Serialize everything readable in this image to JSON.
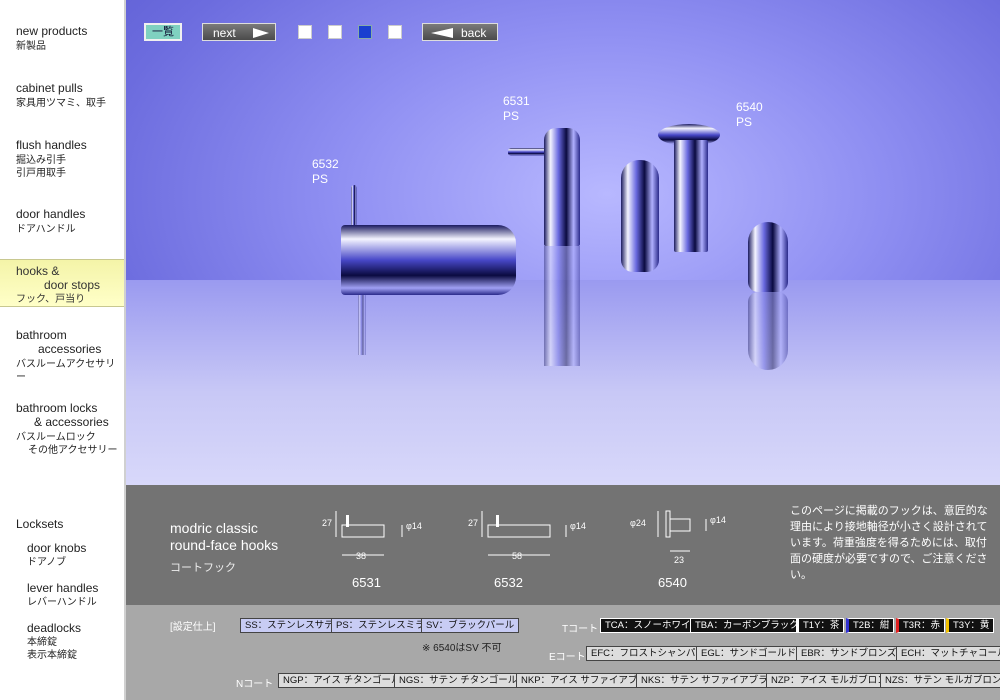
{
  "sidebar": {
    "items": [
      {
        "en": "new products",
        "jp": "新製品"
      },
      {
        "en": "cabinet pulls",
        "jp": "家具用ツマミ、取手"
      },
      {
        "en": "flush handles",
        "jp": "掘込み引手",
        "jp2": "引戸用取手"
      },
      {
        "en": "door handles",
        "jp": "ドアハンドル"
      },
      {
        "en": "hooks &",
        "en2": "door stops",
        "jp": "フック、戸当り"
      },
      {
        "en": "bathroom",
        "en2": "accessories",
        "jp": "バスルームアクセサリー"
      },
      {
        "en": "bathroom locks",
        "en2": "& accessories",
        "jp": "バスルームロック",
        "jp2": "その他アクセサリー"
      }
    ],
    "locksets_heading": "Locksets",
    "locksets": [
      {
        "en": "door knobs",
        "jp": "ドアノブ"
      },
      {
        "en": "lever handles",
        "jp": "レバーハンドル"
      },
      {
        "en": "deadlocks",
        "jp": "本締錠",
        "jp2": "表示本締錠"
      }
    ],
    "active_index": 4
  },
  "toolbar": {
    "list_label": "一覧",
    "next_label": "next",
    "back_label": "back",
    "page_count": 4,
    "current_page": 3
  },
  "photo": {
    "labels": [
      {
        "code": "6532",
        "finish": "PS"
      },
      {
        "code": "6531",
        "finish": "PS"
      },
      {
        "code": "6540",
        "finish": "PS"
      }
    ]
  },
  "info": {
    "name_line1": "modric classic",
    "name_line2": "round-face hooks",
    "name_jp": "コートフック",
    "drawings": [
      {
        "code": "6531",
        "height": "27",
        "dia": "φ14",
        "length": "38"
      },
      {
        "code": "6532",
        "height": "27",
        "dia": "φ14",
        "length": "58"
      },
      {
        "code": "6540",
        "height": "φ24",
        "dia": "φ14",
        "length": "23"
      }
    ],
    "note": "このページに掲載のフックは、意匠的な理由により接地軸径が小さく設計されています。荷重強度を得るためには、取付面の硬度が必要ですので、ご注意ください。"
  },
  "finishes": {
    "heading": "[設定仕上]",
    "basic": [
      "SS：ステンレスサテン",
      "PS：ステンレスミラー",
      "SV：ブラックパール"
    ],
    "basic_note": "※ 6540はSV 不可",
    "t_label": "Tコート",
    "t": [
      "TCA：スノーホワイト",
      "TBA：カーボンブラック",
      "T1Y：茶",
      "T2B：紺",
      "T3R：赤",
      "T3Y：黄"
    ],
    "e_label": "Eコート",
    "e": [
      "EFC：フロストシャンパン",
      "EGL：サンドゴールド",
      "EBR：サンドブロンズ",
      "ECH：マットチャコール"
    ],
    "n_label": "Nコート",
    "n": [
      "NGP：アイス チタンゴールド",
      "NGS：サテン チタンゴールド",
      "NKP：アイス サファイアブラック",
      "NKS：サテン サファイアブラック",
      "NZP：アイス モルガブロンズ",
      "NZS：サテン モルガブロンズ"
    ]
  },
  "colors": {
    "accent_active": "#ffffc8",
    "photo_bg": "#8f8ff2",
    "info_bg": "#737373",
    "finish_bg": "#a8a8a8"
  }
}
